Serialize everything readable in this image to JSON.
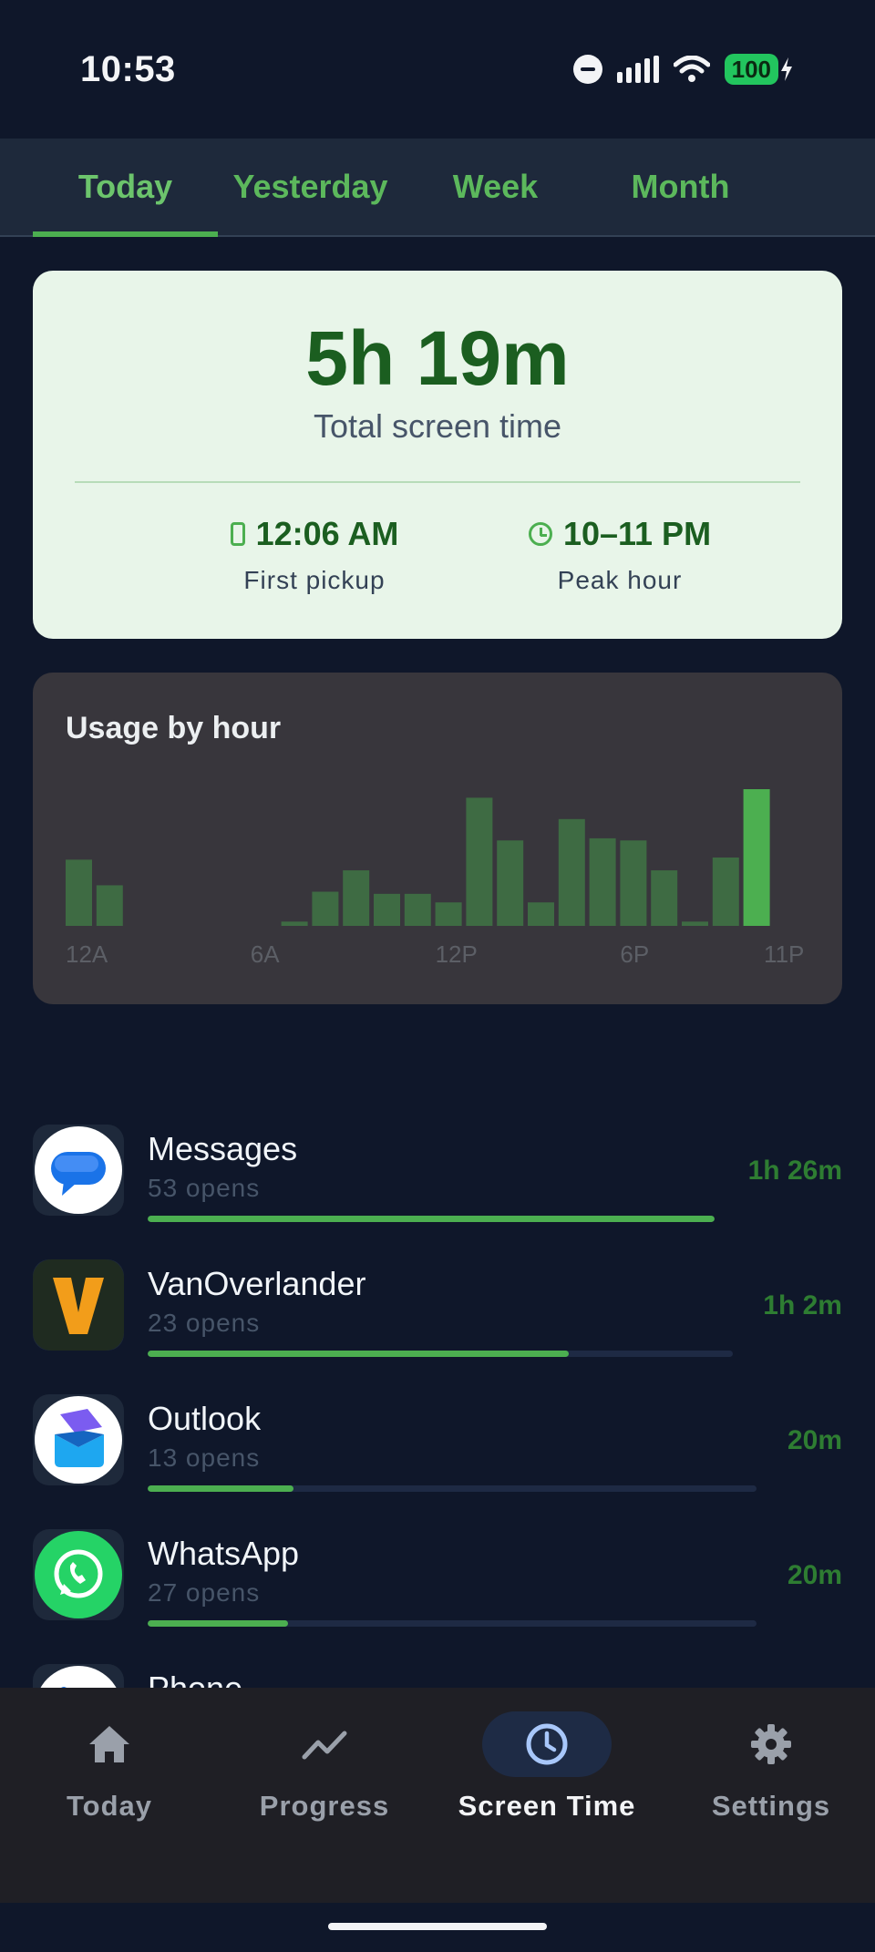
{
  "status_bar": {
    "time": "10:53",
    "battery": "100"
  },
  "tabs": [
    {
      "label": "Today",
      "active": true
    },
    {
      "label": "Yesterday",
      "active": false
    },
    {
      "label": "Week",
      "active": false
    },
    {
      "label": "Month",
      "active": false
    }
  ],
  "summary": {
    "total_time": "5h 19m",
    "total_label": "Total screen time",
    "first_pickup": {
      "value": "12:06 AM",
      "label": "First pickup"
    },
    "peak_hour": {
      "value": "10–11 PM",
      "label": "Peak hour"
    }
  },
  "hourly": {
    "title": "Usage by hour",
    "chart_data": {
      "type": "bar",
      "title": "Usage by hour",
      "categories": [
        "12A",
        "1A",
        "2A",
        "3A",
        "4A",
        "5A",
        "6A",
        "7A",
        "8A",
        "9A",
        "10A",
        "11A",
        "12P",
        "1P",
        "2P",
        "3P",
        "4P",
        "5P",
        "6P",
        "7P",
        "8P",
        "9P",
        "10P",
        "11P"
      ],
      "tick_labels": [
        "12A",
        "6A",
        "12P",
        "6P",
        "11P"
      ],
      "values": [
        31,
        19,
        0,
        0,
        0,
        0,
        0,
        2,
        16,
        26,
        15,
        15,
        11,
        60,
        40,
        11,
        50,
        41,
        40,
        26,
        2,
        32,
        64,
        0
      ],
      "highlight_index": 22,
      "units": "relative",
      "ylim": [
        0,
        64
      ],
      "grid": false,
      "colors": {
        "bar": "#3e6b43",
        "highlight": "#4caf50"
      }
    }
  },
  "apps": [
    {
      "name": "Messages",
      "opens": "53 opens",
      "time": "1h 26m",
      "share": 1.0,
      "icon": "messages-icon"
    },
    {
      "name": "VanOverlander",
      "opens": "23 opens",
      "time": "1h 2m",
      "share": 0.72,
      "icon": "vanoverlander-icon"
    },
    {
      "name": "Outlook",
      "opens": "13 opens",
      "time": "20m",
      "share": 0.24,
      "icon": "outlook-icon"
    },
    {
      "name": "WhatsApp",
      "opens": "27 opens",
      "time": "20m",
      "share": 0.23,
      "icon": "whatsapp-icon"
    },
    {
      "name": "Phone",
      "opens": "",
      "time": "",
      "share": 0,
      "icon": "phone-icon"
    }
  ],
  "nav": [
    {
      "label": "Today",
      "icon": "home-icon",
      "active": false
    },
    {
      "label": "Progress",
      "icon": "trend-icon",
      "active": false
    },
    {
      "label": "Screen Time",
      "icon": "clock-icon",
      "active": true
    },
    {
      "label": "Settings",
      "icon": "gear-icon",
      "active": false
    }
  ],
  "colors": {
    "accent": "#4caf50",
    "background": "#0f172a",
    "card_light": "#e8f5e9",
    "card_dark": "#38363c"
  }
}
